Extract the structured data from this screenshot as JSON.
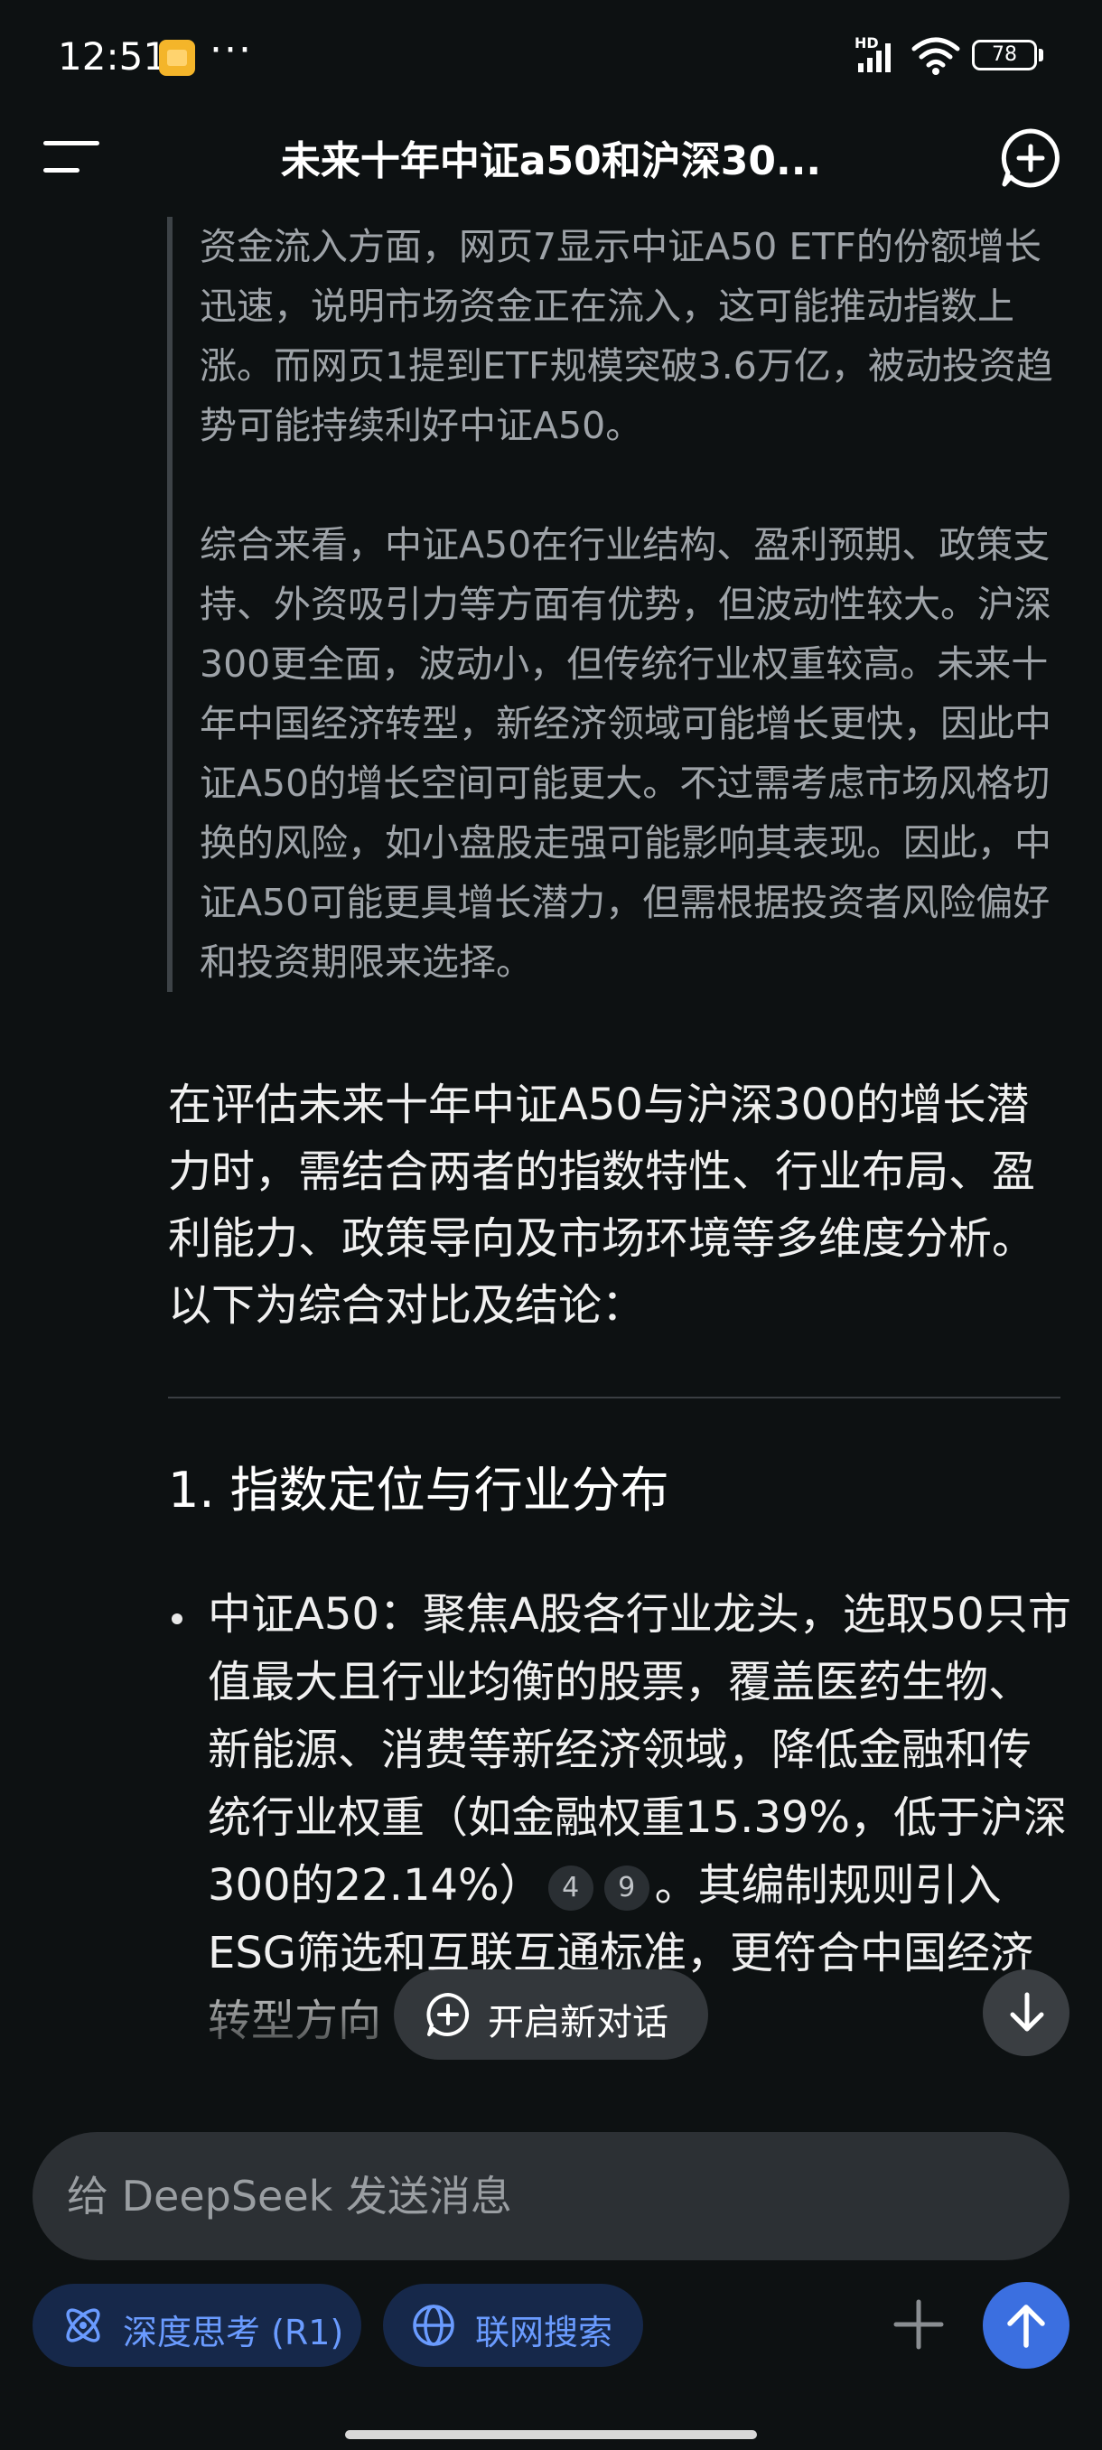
{
  "status_bar": {
    "time": "12:51",
    "more": "···",
    "network_badge": "HD",
    "battery": "78"
  },
  "header": {
    "title": "未来十年中证a50和沪深30...",
    "menu_icon": "hamburger-menu-icon",
    "new_chat_icon": "chat-plus-icon"
  },
  "thinking_quote": {
    "paragraphs": [
      "资金流入方面，网页7显示中证A50 ETF的份额增长迅速，说明市场资金正在流入，这可能推动指数上涨。而网页1提到ETF规模突破3.6万亿，被动投资趋势可能持续利好中证A50。",
      "综合来看，中证A50在行业结构、盈利预期、政策支持、外资吸引力等方面有优势，但波动性较大。沪深300更全面，波动小，但传统行业权重较高。未来十年中国经济转型，新经济领域可能增长更快，因此中证A50的增长空间可能更大。不过需考虑市场风格切换的风险，如小盘股走强可能影响其表现。因此，中证A50可能更具增长潜力，但需根据投资者风险偏好和投资期限来选择。"
    ]
  },
  "answer": {
    "intro": "在评估未来十年中证A50与沪深300的增长潜力时，需结合两者的指数特性、行业布局、盈利能力、政策导向及市场环境等多维度分析。以下为综合对比及结论：",
    "section1_heading": "1. 指数定位与行业分布",
    "bullet1": {
      "part1": "中证A50：聚焦A股各行业龙头，选取50只市值最大且行业均衡的股票，覆盖医药生物、新能源、消费等新经济领域，降低金融和传统行业权重（如金融权重15.39%，低于沪深300的22.14%）",
      "cite1": "4",
      "cite2": "9",
      "part2": "。其编制规则引入ESG筛选和互联互通标准，更符合中国经济转型方向（如“新质生产力"
    }
  },
  "floating": {
    "new_chat_label": "开启新对话"
  },
  "composer": {
    "placeholder": "给 DeepSeek 发送消息",
    "deep_think_label": "深度思考 (R1)",
    "web_search_label": "联网搜索"
  },
  "colors": {
    "background": "#0d1112",
    "accent": "#3b6fe0",
    "chip_text": "#6a9bff",
    "quote_text": "#9ea3a8"
  }
}
